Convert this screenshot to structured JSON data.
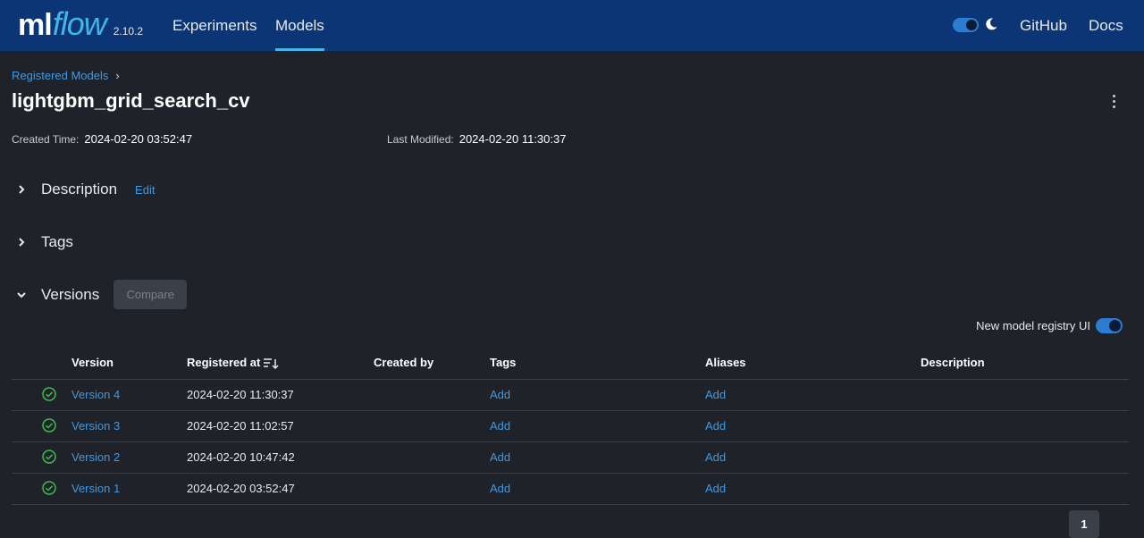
{
  "app": {
    "logo_ml": "ml",
    "logo_flow": "flow",
    "version": "2.10.2",
    "nav": [
      {
        "label": "Experiments",
        "active": false
      },
      {
        "label": "Models",
        "active": true
      }
    ],
    "right_links": [
      "GitHub",
      "Docs"
    ]
  },
  "breadcrumb": {
    "label": "Registered Models",
    "separator": "›"
  },
  "model": {
    "name": "lightgbm_grid_search_cv",
    "created_label": "Created Time:",
    "created_value": "2024-02-20 03:52:47",
    "modified_label": "Last Modified:",
    "modified_value": "2024-02-20 11:30:37"
  },
  "sections": {
    "description": "Description",
    "description_edit": "Edit",
    "tags": "Tags",
    "versions": "Versions",
    "compare": "Compare"
  },
  "registry_toggle": {
    "label": "New model registry UI",
    "on": true
  },
  "table": {
    "headers": [
      "Version",
      "Registered at",
      "Created by",
      "Tags",
      "Aliases",
      "Description"
    ],
    "rows": [
      {
        "version": "Version 4",
        "registered": "2024-02-20 11:30:37",
        "created_by": "",
        "tags": "Add",
        "aliases": "Add",
        "description": ""
      },
      {
        "version": "Version 3",
        "registered": "2024-02-20 11:02:57",
        "created_by": "",
        "tags": "Add",
        "aliases": "Add",
        "description": ""
      },
      {
        "version": "Version 2",
        "registered": "2024-02-20 10:47:42",
        "created_by": "",
        "tags": "Add",
        "aliases": "Add",
        "description": ""
      },
      {
        "version": "Version 1",
        "registered": "2024-02-20 03:52:47",
        "created_by": "",
        "tags": "Add",
        "aliases": "Add",
        "description": ""
      }
    ]
  },
  "pagination": {
    "current_page": "1"
  },
  "colors": {
    "nav_bg": "#0b3574",
    "page_bg": "#1f2228",
    "link": "#4299e1",
    "success": "#3fb950",
    "accent": "#43b5e6"
  }
}
